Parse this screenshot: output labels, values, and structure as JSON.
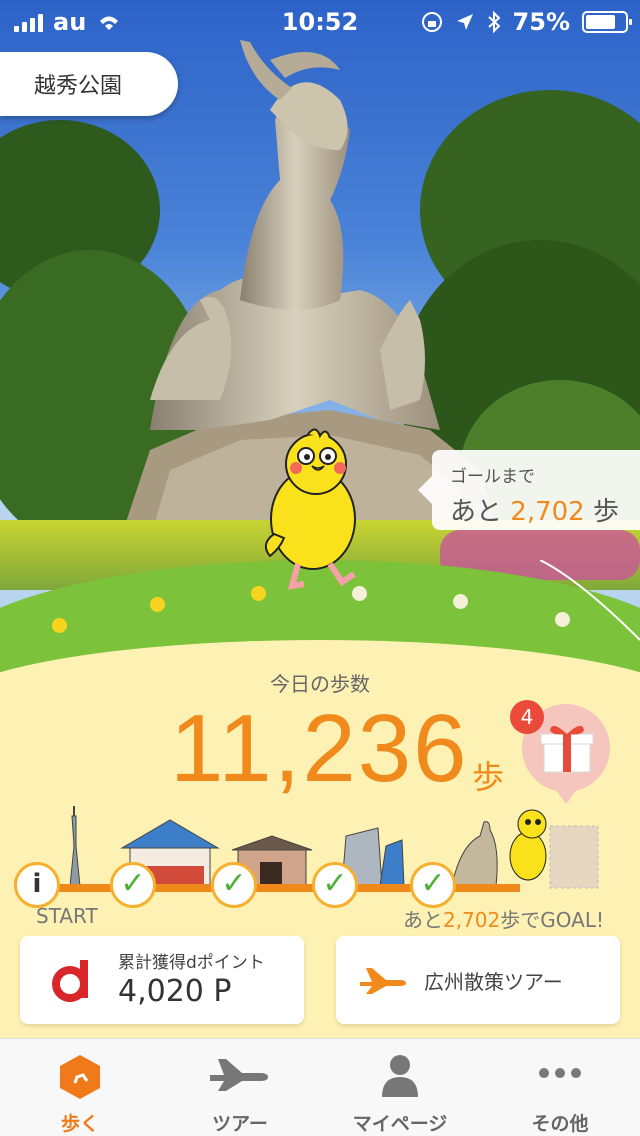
{
  "status_bar": {
    "carrier": "au",
    "time": "10:52",
    "battery": "75%"
  },
  "location": {
    "name": "越秀公園"
  },
  "goal": {
    "label": "ゴールまで",
    "prefix": "あと",
    "steps": "2,702",
    "unit": "歩"
  },
  "steps": {
    "label": "今日の歩数",
    "value": "11,236",
    "unit": "歩"
  },
  "gift": {
    "badge_count": "4"
  },
  "progress": {
    "start_label": "START",
    "remain_prefix": "あと",
    "remain_steps": "2,702",
    "remain_suffix": "歩でGOAL!",
    "info_symbol": "i"
  },
  "points_card": {
    "label": "累計獲得dポイント",
    "value": "4,020 P"
  },
  "tour_card": {
    "label": "広州散策ツアー"
  },
  "tabs": [
    {
      "label": "歩く",
      "icon": "walk-hexagon-icon",
      "active": true
    },
    {
      "label": "ツアー",
      "icon": "airplane-icon",
      "active": false
    },
    {
      "label": "マイページ",
      "icon": "person-icon",
      "active": false
    },
    {
      "label": "その他",
      "icon": "more-dots-icon",
      "active": false
    }
  ],
  "colors": {
    "accent": "#f08a1c",
    "green": "#7cc23a",
    "cream": "#fdf1b4",
    "badge": "#e94a3a"
  }
}
